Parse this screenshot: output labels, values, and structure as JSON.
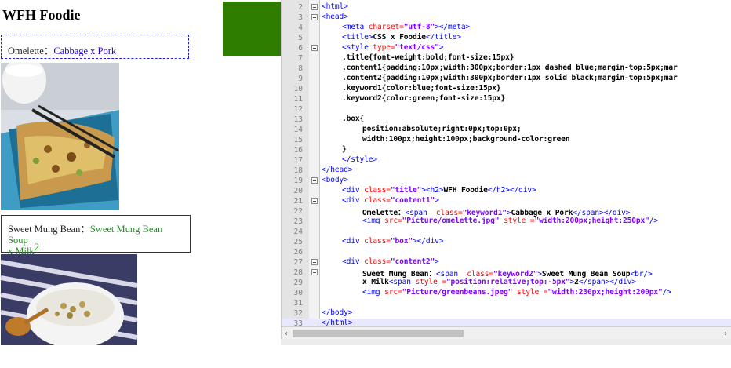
{
  "preview": {
    "heading": "WFH Foodie",
    "content1": {
      "label": "Omelette：",
      "keyword": "Cabbage x Pork"
    },
    "content2": {
      "label": "Sweet Mung Bean：",
      "keyword_line1": "Sweet Mung Bean Soup",
      "keyword_line2": "x Milk",
      "sup": "2"
    },
    "box_color": "#2e7d00"
  },
  "editor": {
    "lines": [
      {
        "n": "2"
      },
      {
        "n": "3"
      },
      {
        "n": "4"
      },
      {
        "n": "5"
      },
      {
        "n": "6"
      },
      {
        "n": "7"
      },
      {
        "n": "8"
      },
      {
        "n": "9"
      },
      {
        "n": "10"
      },
      {
        "n": "11"
      },
      {
        "n": "12"
      },
      {
        "n": "13"
      },
      {
        "n": "14"
      },
      {
        "n": "15"
      },
      {
        "n": "16"
      },
      {
        "n": "17"
      },
      {
        "n": "18"
      },
      {
        "n": "19"
      },
      {
        "n": "20"
      },
      {
        "n": "21"
      },
      {
        "n": "22"
      },
      {
        "n": "23"
      },
      {
        "n": "24"
      },
      {
        "n": "25"
      },
      {
        "n": "26"
      },
      {
        "n": "27"
      },
      {
        "n": "28"
      },
      {
        "n": "29"
      },
      {
        "n": "30"
      },
      {
        "n": "31"
      },
      {
        "n": "32"
      },
      {
        "n": "33"
      }
    ],
    "code": {
      "l2_tag": "<html>",
      "l3_tag": "<head>",
      "l4_open": "<meta ",
      "l4_attr": "charset=",
      "l4_val": "\"utf-8\"",
      "l4_close": "></meta>",
      "l5_open": "<title>",
      "l5_text": "CSS x Foodie",
      "l5_close": "</title>",
      "l6_open": "<style ",
      "l6_attr": "type=",
      "l6_val": "\"text/css\"",
      "l6_close": ">",
      "l7": ".title{font-weight:bold;font-size:15px}",
      "l8": ".content1{padding:10px;width:300px;border:1px dashed blue;margin-top:5px;mar",
      "l9": ".content2{padding:10px;width:300px;border:1px solid black;margin-top:5px;mar",
      "l10": ".keyword1{color:blue;font-size:15px}",
      "l11": ".keyword2{color:green;font-size:15px}",
      "l13": ".box{",
      "l14": "position:absolute;right:0px;top:0px;",
      "l15": "width:100px;height:100px;background-color:green",
      "l16": "}",
      "l17": "</style>",
      "l18": "</head>",
      "l19": "<body>",
      "l20_a": "<div ",
      "l20_b": "class=",
      "l20_c": "\"title\"",
      "l20_d": "><h2>",
      "l20_e": "WFH Foodie",
      "l20_f": "</h2></div>",
      "l21_a": "<div ",
      "l21_b": "class=",
      "l21_c": "\"content1\"",
      "l21_d": ">",
      "l22_a": "Omelette：",
      "l22_b": "<span  ",
      "l22_c": "class=",
      "l22_d": "\"keyword1\"",
      "l22_e": ">",
      "l22_f": "Cabbage x Pork",
      "l22_g": "</span></div>",
      "l23_a": "<img ",
      "l23_b": "src=",
      "l23_c": "\"Picture/omelette.jpg\"",
      "l23_d": " style =",
      "l23_e": "\"width:200px;height:250px\"",
      "l23_f": "/>",
      "l25_a": "<div ",
      "l25_b": "class=",
      "l25_c": "\"box\"",
      "l25_d": "></div>",
      "l27_a": "<div ",
      "l27_b": "class=",
      "l27_c": "\"content2\"",
      "l27_d": ">",
      "l28_a": "Sweet Mung Bean：",
      "l28_b": "<span  ",
      "l28_c": "class=",
      "l28_d": "\"keyword2\"",
      "l28_e": ">",
      "l28_f": "Sweet Mung Bean Soup",
      "l28_g": "<br/>",
      "l29_a": "x Milk",
      "l29_b": "<span ",
      "l29_c": "style =",
      "l29_d": "\"position:relative;top:-5px\"",
      "l29_e": ">",
      "l29_f": "2",
      "l29_g": "</span></div>",
      "l30_a": "<img ",
      "l30_b": "src=",
      "l30_c": "\"Picture/greenbeans.jpeg\"",
      "l30_d": " style =",
      "l30_e": "\"width:230px;height:200px\"",
      "l30_f": "/>",
      "l32": "</body>",
      "l33": "</html>"
    }
  },
  "scrollbar": {
    "left_arrow": "‹",
    "right_arrow": "›"
  }
}
